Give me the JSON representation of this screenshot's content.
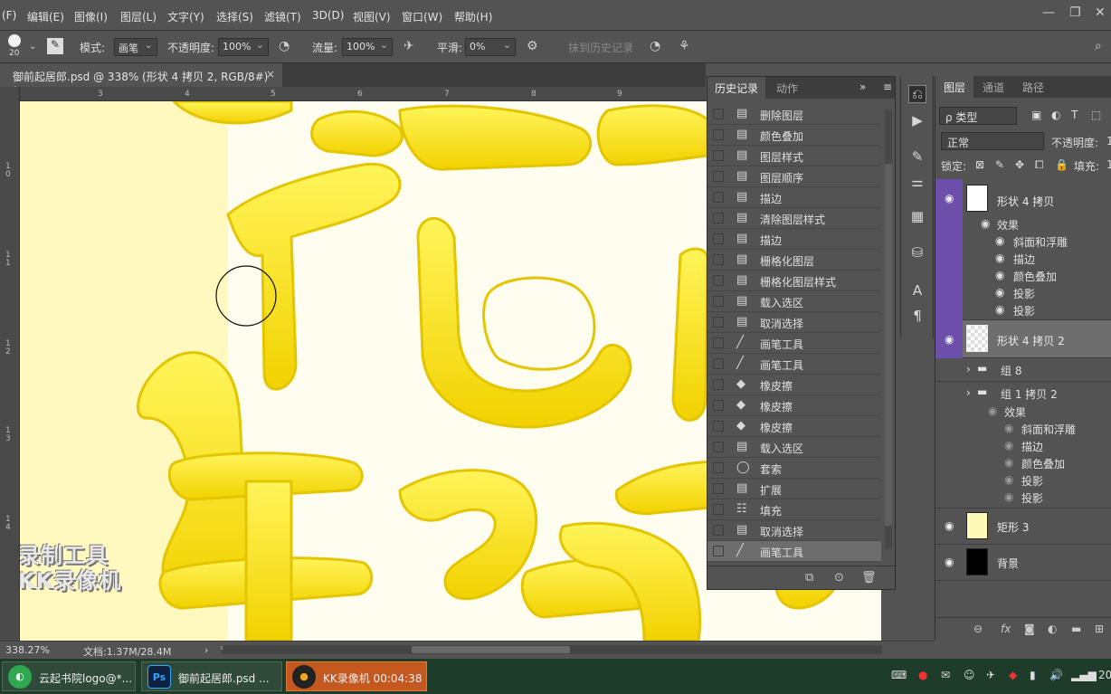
{
  "menu": [
    "(F)",
    "编辑(E)",
    "图像(I)",
    "图层(L)",
    "文字(Y)",
    "选择(S)",
    "滤镜(T)",
    "3D(D)",
    "视图(V)",
    "窗口(W)",
    "帮助(H)"
  ],
  "window_controls": {
    "minimize": "—",
    "restore": "❐",
    "close": "✕"
  },
  "options": {
    "brush_size": "20",
    "mode_label": "模式:",
    "mode_value": "画笔",
    "opacity_label": "不透明度:",
    "opacity_value": "100%",
    "flow_label": "流量:",
    "flow_value": "100%",
    "smooth_label": "平滑:",
    "smooth_value": "0%",
    "erase_to_history": "抹到历史记录"
  },
  "document": {
    "tab_title": "御前起居郎.psd @ 338% (形状 4 拷贝 2, RGB/8#) *",
    "close": "×",
    "ruler_h": [
      "3",
      "4",
      "5",
      "6",
      "7",
      "8",
      "9"
    ],
    "ruler_v": [
      "1\n0",
      "1\n1",
      "1\n2",
      "1\n3",
      "1\n4"
    ]
  },
  "watermark": {
    "line1": "录制工具",
    "line2": "KK录像机"
  },
  "status": {
    "zoom": "338.27%",
    "doc_info": "文档:1.37M/28.4M",
    "arrow": "›",
    "left_arrow": "‹"
  },
  "history_panel": {
    "tabs": [
      "历史记录",
      "动作"
    ],
    "items": [
      {
        "icon": "doc",
        "label": "删除图层"
      },
      {
        "icon": "doc",
        "label": "颜色叠加"
      },
      {
        "icon": "doc",
        "label": "图层样式"
      },
      {
        "icon": "doc",
        "label": "图层顺序"
      },
      {
        "icon": "doc",
        "label": "描边"
      },
      {
        "icon": "doc",
        "label": "清除图层样式"
      },
      {
        "icon": "doc",
        "label": "描边"
      },
      {
        "icon": "doc",
        "label": "栅格化图层"
      },
      {
        "icon": "doc",
        "label": "栅格化图层样式"
      },
      {
        "icon": "doc",
        "label": "载入选区"
      },
      {
        "icon": "doc",
        "label": "取消选择"
      },
      {
        "icon": "brush",
        "label": "画笔工具"
      },
      {
        "icon": "brush",
        "label": "画笔工具"
      },
      {
        "icon": "eraser",
        "label": "橡皮擦"
      },
      {
        "icon": "eraser",
        "label": "橡皮擦"
      },
      {
        "icon": "eraser",
        "label": "橡皮擦"
      },
      {
        "icon": "doc",
        "label": "载入选区"
      },
      {
        "icon": "lasso",
        "label": "套索"
      },
      {
        "icon": "doc",
        "label": "扩展"
      },
      {
        "icon": "fill",
        "label": "填充"
      },
      {
        "icon": "doc",
        "label": "取消选择"
      },
      {
        "icon": "brush",
        "label": "画笔工具"
      }
    ],
    "selected_index": 21
  },
  "layers_panel": {
    "tabs": [
      "图层",
      "通道",
      "路径"
    ],
    "filter_label": "ρ 类型",
    "blend_mode": "正常",
    "opacity_label": "不透明度:",
    "opacity_value": "1",
    "lock_label": "锁定:",
    "fill_label": "填充:",
    "fill_value": "1",
    "layers": [
      {
        "name": "形状 4 拷贝",
        "effects_label": "效果",
        "effects": [
          "斜面和浮雕",
          "描边",
          "颜色叠加",
          "投影",
          "投影"
        ]
      },
      {
        "name": "形状 4 拷贝 2"
      },
      {
        "name": "组 8"
      },
      {
        "name": "组 1 拷贝 2",
        "effects_label": "效果",
        "effects": [
          "斜面和浮雕",
          "描边",
          "颜色叠加",
          "投影",
          "投影"
        ]
      },
      {
        "name": "矩形 3"
      },
      {
        "name": "背景"
      }
    ],
    "footer_icons": [
      "link-icon",
      "fx",
      "mask-icon",
      "adjustment-icon",
      "folder-icon",
      "new-layer-icon"
    ]
  },
  "taskbar": {
    "buttons": [
      {
        "label": "云起书院logo@*..."
      },
      {
        "label": "御前起居郎.psd ..."
      },
      {
        "label": "KK录像机 00:04:38"
      }
    ],
    "clock": "20"
  },
  "colors": {
    "accent_purple": "#6b4fa8",
    "selected_history": "#6d6d6d",
    "canvas_yellow": "#ffe822",
    "canvas_bg": "#fffdf0",
    "taskbar_active": "#c4581f"
  }
}
